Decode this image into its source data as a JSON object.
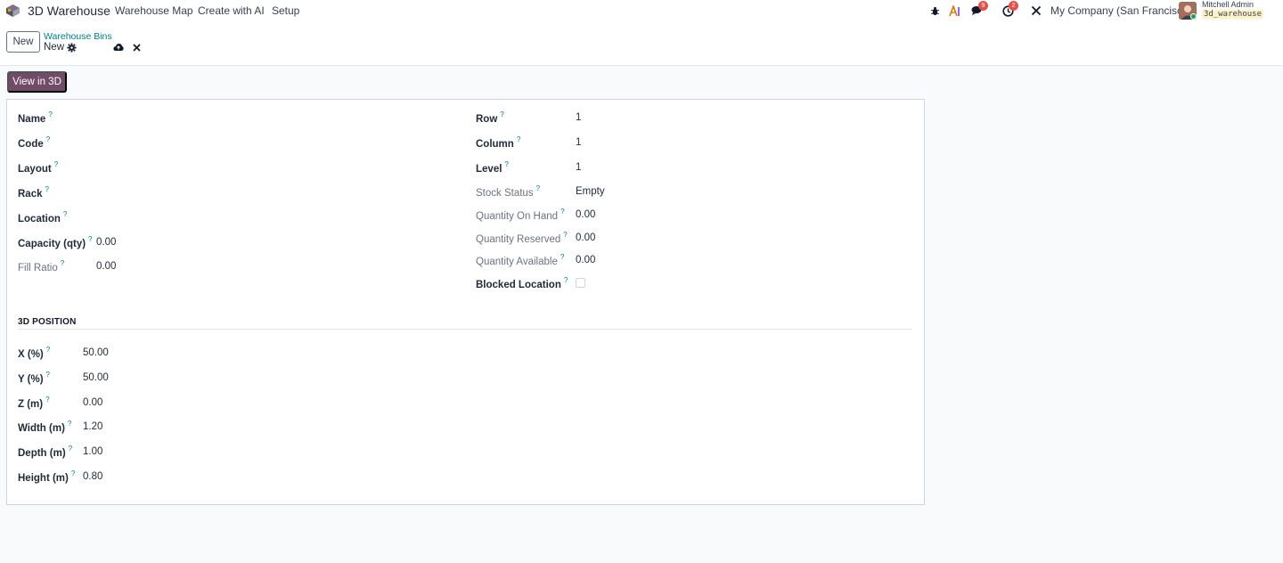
{
  "navbar": {
    "app_name": "3D Warehouse",
    "menu": [
      "Warehouse Map",
      "Create with AI",
      "Setup"
    ],
    "messages_count": "9",
    "activities_count": "2",
    "company": "My Company (San Francisco)",
    "user_name": "Mitchell Admin",
    "db_name": "3d_warehouse"
  },
  "control": {
    "new_label": "New",
    "breadcrumb": "Warehouse Bins",
    "record_name": "New"
  },
  "actions": {
    "view_3d_label": "View in 3D"
  },
  "form": {
    "left_fields": [
      {
        "label": "Name",
        "value": ""
      },
      {
        "label": "Code",
        "value": ""
      },
      {
        "label": "Layout",
        "value": ""
      },
      {
        "label": "Rack",
        "value": ""
      },
      {
        "label": "Location",
        "value": ""
      },
      {
        "label": "Capacity (qty)",
        "value": "0.00"
      },
      {
        "label": "Fill Ratio",
        "value": "0.00"
      }
    ],
    "right_fields": [
      {
        "label": "Row",
        "value": "1"
      },
      {
        "label": "Column",
        "value": "1"
      },
      {
        "label": "Level",
        "value": "1"
      },
      {
        "label": "Stock Status",
        "value": "Empty"
      },
      {
        "label": "Quantity On Hand",
        "value": "0.00"
      },
      {
        "label": "Quantity Reserved",
        "value": "0.00"
      },
      {
        "label": "Quantity Available",
        "value": "0.00"
      },
      {
        "label": "Blocked Location",
        "value": ""
      }
    ],
    "blocked_location_checked": false,
    "section_title": "3D POSITION",
    "position_fields": [
      {
        "label": "X (%)",
        "value": "50.00"
      },
      {
        "label": "Y (%)",
        "value": "50.00"
      },
      {
        "label": "Z (m)",
        "value": "0.00"
      },
      {
        "label": "Width (m)",
        "value": "1.20"
      },
      {
        "label": "Depth (m)",
        "value": "1.00"
      },
      {
        "label": "Height (m)",
        "value": "0.80"
      }
    ],
    "help_marker": "?"
  }
}
